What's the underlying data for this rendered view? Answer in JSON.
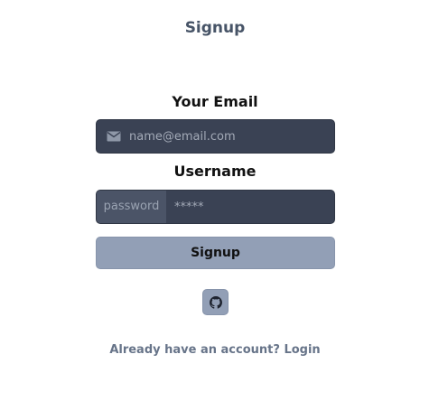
{
  "form": {
    "title": "Signup",
    "email_label": "Your Email",
    "email_placeholder": "name@email.com",
    "email_icon": "mail-icon",
    "username_label": "Username",
    "password_addon": "password",
    "password_value": "*****",
    "submit_label": "Signup",
    "github_icon": "github-icon",
    "login_link": "Already have an account? Login"
  },
  "colors": {
    "input_bg": "#3a4254",
    "addon_bg": "#4b5467",
    "button_bg": "#929fb6",
    "title_text": "#475467",
    "link_text": "#677489"
  }
}
